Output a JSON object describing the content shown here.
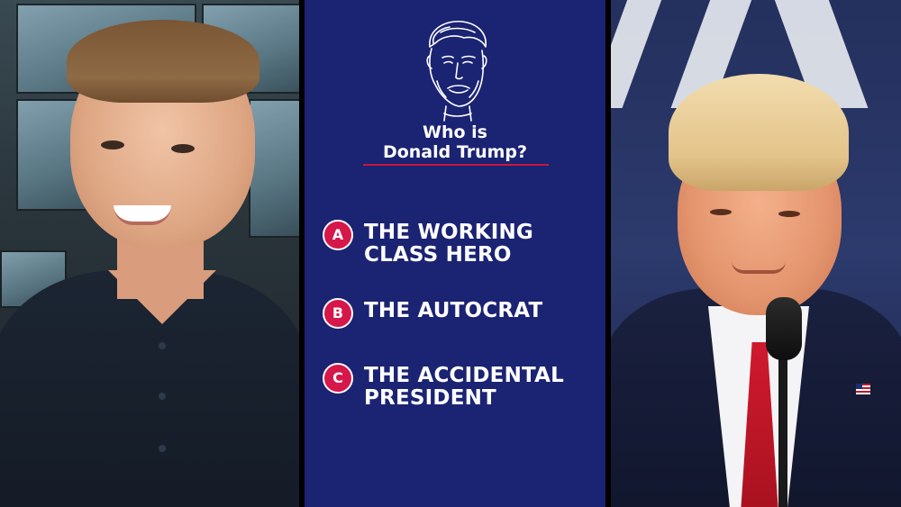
{
  "quiz": {
    "title_line1": "Who is",
    "title_line2": "Donald Trump?",
    "options": [
      {
        "letter": "A",
        "label_line1": "THE WORKING",
        "label_line2": "CLASS HERO"
      },
      {
        "letter": "B",
        "label_line1": "THE AUTOCRAT",
        "label_line2": ""
      },
      {
        "letter": "C",
        "label_line1": "THE ACCIDENTAL",
        "label_line2": "PRESIDENT"
      }
    ]
  },
  "colors": {
    "center_background": "#1b2373",
    "accent_red": "#d6174a",
    "text": "#ffffff"
  },
  "panels": {
    "left": {
      "icon": "presenter-video"
    },
    "center": {
      "icon": "portrait-sketch-icon"
    },
    "right": {
      "icon": "speaker-video"
    }
  }
}
